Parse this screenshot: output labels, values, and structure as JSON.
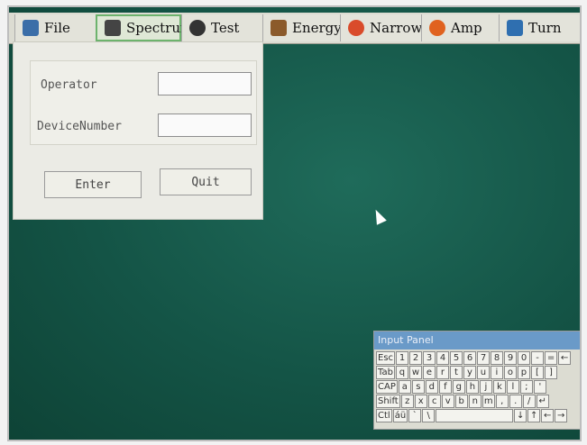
{
  "toolbar": {
    "items": [
      {
        "label": "File",
        "icon": "monitor-icon",
        "color": "#3b6ea8"
      },
      {
        "label": "Spectrum",
        "icon": "speaker-icon",
        "color": "#444444"
      },
      {
        "label": "Test",
        "icon": "person-icon",
        "color": "#333333"
      },
      {
        "label": "Energy",
        "icon": "book-icon",
        "color": "#8b5a2b"
      },
      {
        "label": "Narrow",
        "icon": "minus-circle-icon",
        "color": "#d94b2b"
      },
      {
        "label": "Amp",
        "icon": "plus-circle-icon",
        "color": "#e0621f"
      },
      {
        "label": "Turn",
        "icon": "arrow-icon",
        "color": "#2f6fb0"
      }
    ]
  },
  "login": {
    "operator_label": "Operator",
    "device_label": "DeviceNumber",
    "operator_value": "",
    "device_value": "",
    "enter_label": "Enter",
    "quit_label": "Quit"
  },
  "keyboard": {
    "title": "Input Panel",
    "rows": [
      [
        "Esc",
        "1",
        "2",
        "3",
        "4",
        "5",
        "6",
        "7",
        "8",
        "9",
        "0",
        "-",
        "=",
        "←"
      ],
      [
        "Tab",
        "q",
        "w",
        "e",
        "r",
        "t",
        "y",
        "u",
        "i",
        "o",
        "p",
        "[",
        "]"
      ],
      [
        "CAP",
        "a",
        "s",
        "d",
        "f",
        "g",
        "h",
        "j",
        "k",
        "l",
        ";",
        "'"
      ],
      [
        "Shift",
        "z",
        "x",
        "c",
        "v",
        "b",
        "n",
        "m",
        ",",
        ".",
        "/",
        "↵"
      ],
      [
        "Ctl",
        "áü",
        "`",
        "\\",
        "",
        "↓",
        "↑",
        "←",
        "→"
      ]
    ]
  }
}
